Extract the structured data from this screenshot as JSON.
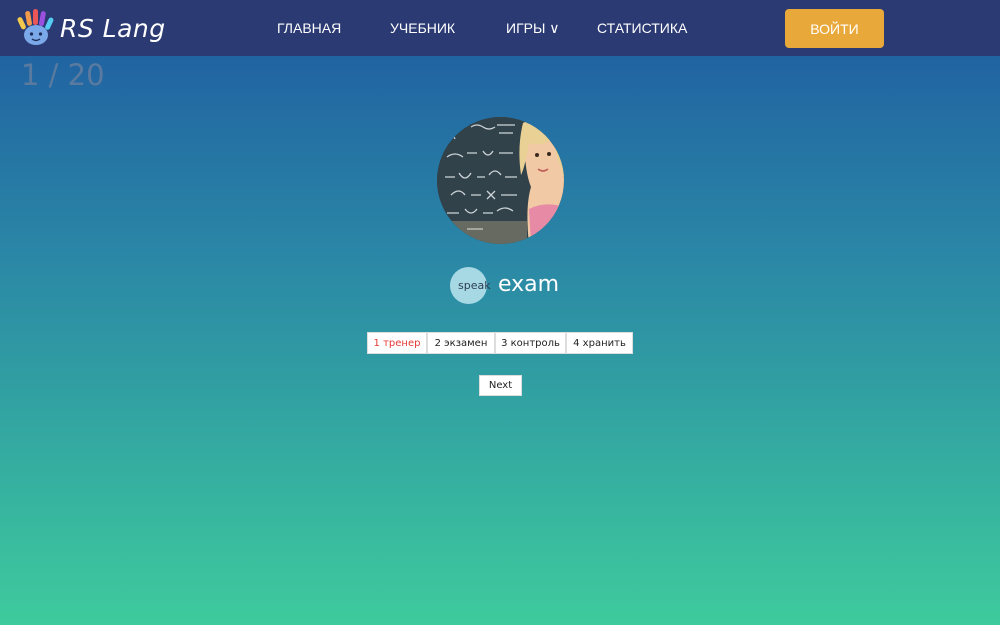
{
  "header": {
    "logo_text": "RS Lang",
    "nav": {
      "home": "ГЛАВНАЯ",
      "textbook": "УЧЕБНИК",
      "games": "ИГРЫ ∨",
      "statistics": "СТАТИСТИКА"
    },
    "login_label": "ВОЙТИ"
  },
  "game": {
    "counter": "1 / 20",
    "speak_label": "speak",
    "word": "exam",
    "options": [
      {
        "label": "1 тренер",
        "active": true
      },
      {
        "label": "2 экзамен",
        "active": false
      },
      {
        "label": "3 контроль",
        "active": false
      },
      {
        "label": "4 хранить",
        "active": false
      }
    ],
    "next_label": "Next"
  },
  "colors": {
    "header_bg": "#2b3a72",
    "login_bg": "#e9a93a",
    "active_option": "#e53935",
    "gradient_top": "#1e5aa1",
    "gradient_bottom": "#3fcb9d"
  }
}
